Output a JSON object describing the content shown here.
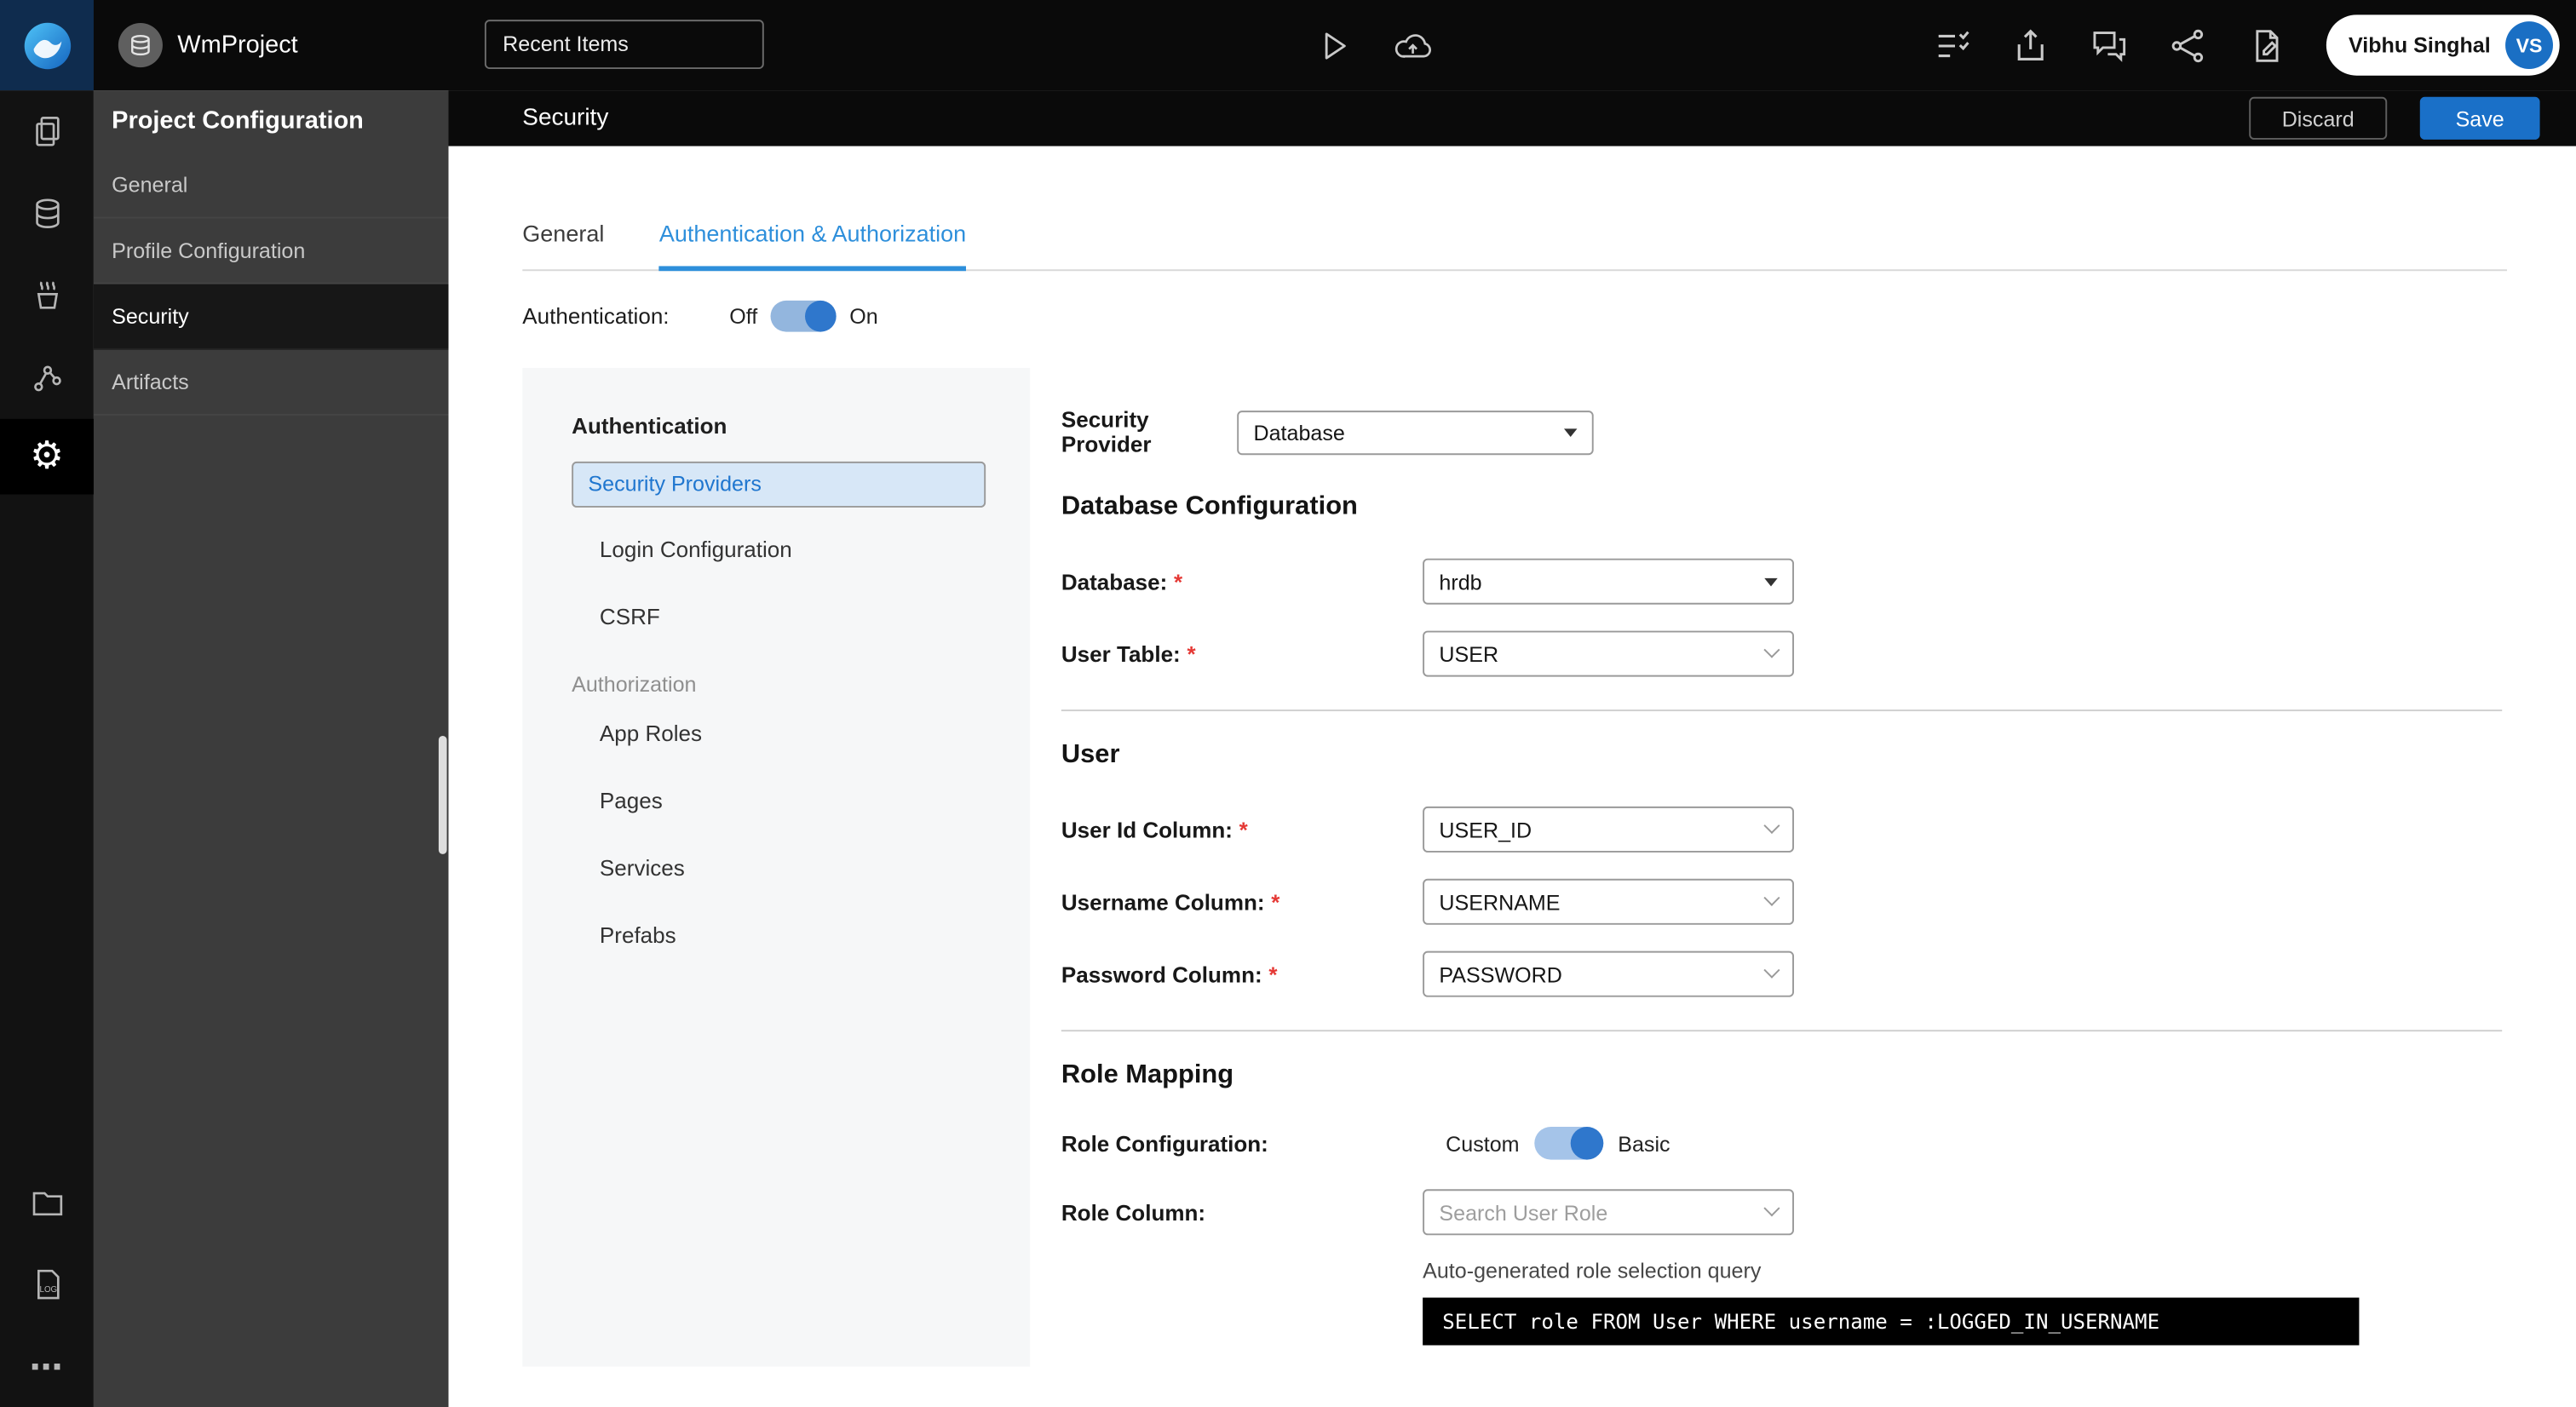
{
  "topbar": {
    "project_name": "WmProject",
    "recent_items_label": "Recent Items",
    "user_name": "Vibhu Singhal",
    "user_initials": "VS",
    "icons": [
      "run",
      "deploy",
      "task-list",
      "export",
      "feedback",
      "share",
      "file-edit"
    ]
  },
  "rail": {
    "icons": [
      "pages",
      "database",
      "java-services",
      "apis",
      "settings",
      "folder",
      "logs",
      "more"
    ],
    "active_icon": "settings"
  },
  "sidebar": {
    "title": "Project Configuration",
    "items": [
      {
        "label": "General",
        "active": false
      },
      {
        "label": "Profile Configuration",
        "active": false
      },
      {
        "label": "Security",
        "active": true
      },
      {
        "label": "Artifacts",
        "active": false
      }
    ]
  },
  "header": {
    "title": "Security",
    "discard_label": "Discard",
    "save_label": "Save"
  },
  "tabs": [
    {
      "label": "General",
      "active": false
    },
    {
      "label": "Authentication & Authorization",
      "active": true
    }
  ],
  "authentication_toggle": {
    "label": "Authentication:",
    "off_label": "Off",
    "on_label": "On",
    "state": "on"
  },
  "auth_menu": {
    "selected": "Security Providers",
    "sections": [
      {
        "title": "Authentication",
        "items": [
          "Security Providers",
          "Login Configuration",
          "CSRF"
        ]
      },
      {
        "title": "Authorization",
        "items": [
          "App Roles",
          "Pages",
          "Services",
          "Prefabs"
        ]
      }
    ]
  },
  "form": {
    "security_provider": {
      "label": "Security Provider",
      "value": "Database"
    },
    "database_section": {
      "title": "Database Configuration",
      "database": {
        "label": "Database:",
        "required": "*",
        "value": "hrdb"
      },
      "user_table": {
        "label": "User Table:",
        "required": "*",
        "value": "USER"
      }
    },
    "user_section": {
      "title": "User",
      "user_id_column": {
        "label": "User Id Column:",
        "required": "*",
        "value": "USER_ID"
      },
      "username_column": {
        "label": "Username Column:",
        "required": "*",
        "value": "USERNAME"
      },
      "password_column": {
        "label": "Password Column:",
        "required": "*",
        "value": "PASSWORD"
      }
    },
    "role_section": {
      "title": "Role Mapping",
      "role_configuration": {
        "label": "Role Configuration:",
        "left_label": "Custom",
        "right_label": "Basic",
        "state": "basic"
      },
      "role_column": {
        "label": "Role Column:",
        "placeholder": "Search User Role"
      },
      "query_caption": "Auto-generated role selection query",
      "query": "SELECT role FROM User WHERE username = :LOGGED_IN_USERNAME"
    }
  },
  "colors": {
    "accent_blue": "#1a70c8",
    "active_tab_blue": "#2e8fdb",
    "toggle_blue": "#2f77cc",
    "selected_menu_bg": "#d7e7f7",
    "selected_menu_text": "#1f76cf",
    "required_red": "#e53935",
    "code_bg": "#000000"
  }
}
